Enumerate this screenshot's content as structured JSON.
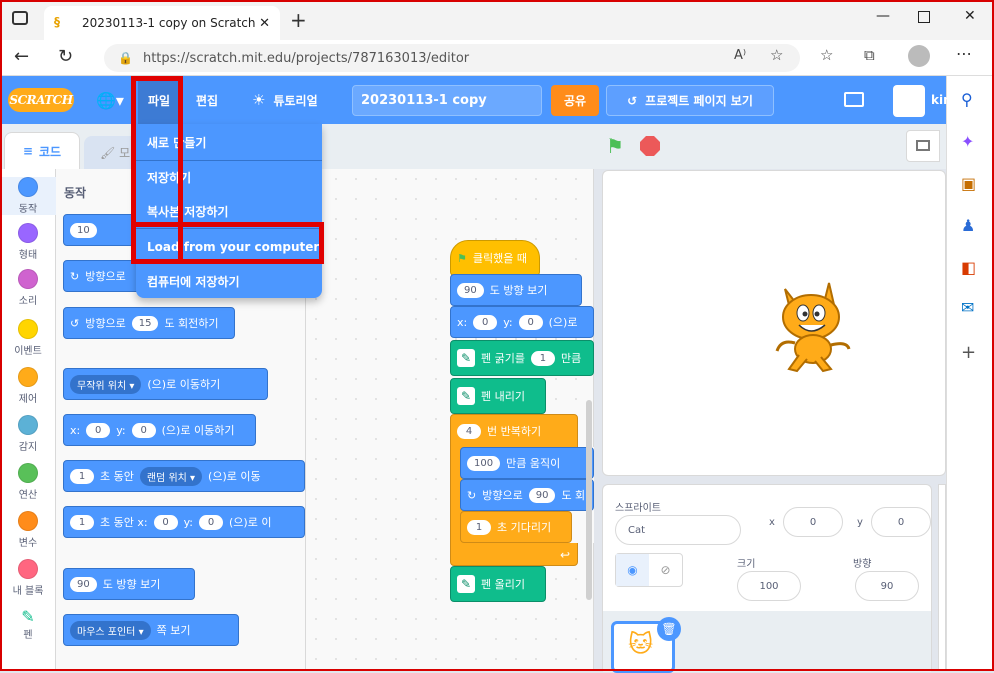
{
  "browser": {
    "tab_title": "20230113-1 copy on Scratch",
    "new_tab": "+",
    "url": "https://scratch.mit.edu/projects/787163013/editor",
    "read_aloud": "A⁾"
  },
  "menubar": {
    "logo": "SCRATCH",
    "file": "파일",
    "edit": "편집",
    "tutorials": "튜토리얼",
    "project_title": "20230113-1 copy",
    "share": "공유",
    "see_project": "프로젝트 페이지 보기",
    "user": "kin"
  },
  "file_menu": {
    "items": [
      "새로 만들기",
      "저장하기",
      "복사본 저장하기",
      "Load from your computer",
      "컴퓨터에 저장하기"
    ]
  },
  "editor_tabs": {
    "code": "코드",
    "costumes": "모"
  },
  "categories": [
    {
      "label": "동작",
      "color": "#4c97ff"
    },
    {
      "label": "형태",
      "color": "#9966ff"
    },
    {
      "label": "소리",
      "color": "#cf63cf"
    },
    {
      "label": "이벤트",
      "color": "#ffd500"
    },
    {
      "label": "제어",
      "color": "#ffab19"
    },
    {
      "label": "감지",
      "color": "#5cb1d6"
    },
    {
      "label": "연산",
      "color": "#59c059"
    },
    {
      "label": "변수",
      "color": "#ff8c1a"
    },
    {
      "label": "내 블록",
      "color": "#ff6680"
    },
    {
      "label": "펜",
      "color": "#0fbd8c"
    }
  ],
  "palette": {
    "heading": "동작",
    "move_steps": "10",
    "turn_right_text": "방향으로",
    "turn_left_val": "15",
    "turn_left_pre": "방향으로",
    "turn_left_post": "도 회전하기",
    "goto_dd": "무작위 위치",
    "goto_post": "(으)로 이동하기",
    "gotoxy_x_lbl": "x:",
    "gotoxy_x": "0",
    "gotoxy_y_lbl": "y:",
    "gotoxy_y": "0",
    "gotoxy_post": "(으)로 이동하기",
    "glide_secs": "1",
    "glide_mid": "초 동안",
    "glide_dd": "랜덤 위치",
    "glide_post": "(으)로 이동",
    "glidexy_secs": "1",
    "glidexy_mid": "초 동안 x:",
    "glidexy_x": "0",
    "glidexy_y_lbl": "y:",
    "glidexy_y": "0",
    "glidexy_post": "(으)로 이",
    "point_val": "90",
    "point_post": "도 방향 보기",
    "pointto_dd": "마우스 포인터",
    "pointto_post": "쪽 보기"
  },
  "script": {
    "hat": "클릭했을 때",
    "point_val": "90",
    "point_post": "도 방향 보기",
    "xy_x_lbl": "x:",
    "xy_x": "0",
    "xy_y_lbl": "y:",
    "xy_y": "0",
    "xy_post": "(으)로",
    "pensize_pre": "펜 굵기를",
    "pensize_val": "1",
    "pensize_post": "만큼",
    "pendown": "펜 내리기",
    "repeat_val": "4",
    "repeat_post": "번 반복하기",
    "move_val": "100",
    "move_post": "만큼 움직이",
    "turn_pre": "방향으로",
    "turn_val": "90",
    "turn_post": "도 회",
    "wait_val": "1",
    "wait_post": "초 기다리기",
    "penup": "펜 올리기"
  },
  "sprite_info": {
    "sprite_label": "스프라이트",
    "sprite_name": "Cat",
    "x_label": "x",
    "x": "0",
    "y_label": "y",
    "y": "0",
    "size_label": "크기",
    "size": "100",
    "direction_label": "방향",
    "direction": "90"
  },
  "colors": {
    "scratch_blue": "#4c97ff",
    "highlight": "#e00000",
    "share": "#ff8c1a"
  }
}
